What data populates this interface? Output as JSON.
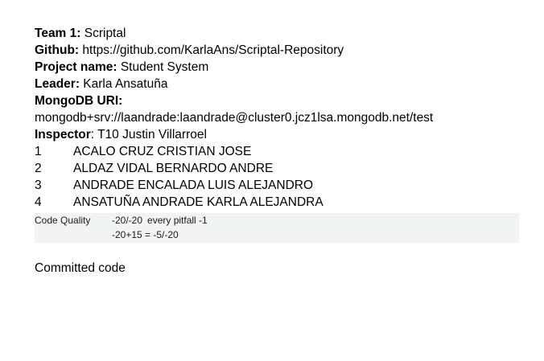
{
  "team": {
    "label": "Team 1:",
    "value": " Scriptal"
  },
  "github": {
    "label": "Github:",
    "value": " https://github.com/KarlaAns/Scriptal-Repository"
  },
  "project": {
    "label": "Project name:",
    "value": " Student System"
  },
  "leader": {
    "label": "Leader:",
    "value": " Karla Ansatuña"
  },
  "mongodb": {
    "label": "MongoDB URI:",
    "value": "mongodb+srv://laandrade:laandrade@cluster0.jcz1lsa.mongodb.net/test"
  },
  "inspector": {
    "label": "Inspector",
    "value": ": T10 Justin Villarroel"
  },
  "members": [
    {
      "num": "1",
      "name": "ACALO CRUZ CRISTIAN JOSE"
    },
    {
      "num": "2",
      "name": "ALDAZ VIDAL BERNARDO ANDRE"
    },
    {
      "num": "3",
      "name": "ANDRADE ENCALADA LUIS ALEJANDRO"
    },
    {
      "num": "4",
      "name": "ANSATUÑA ANDRADE KARLA ALEJANDRA"
    }
  ],
  "code_quality": {
    "label": "Code Quality",
    "score": "-20/-20",
    "rule": "every pitfall -1",
    "total": "-20+15 = -5/-20"
  },
  "committed_heading": "Committed code"
}
